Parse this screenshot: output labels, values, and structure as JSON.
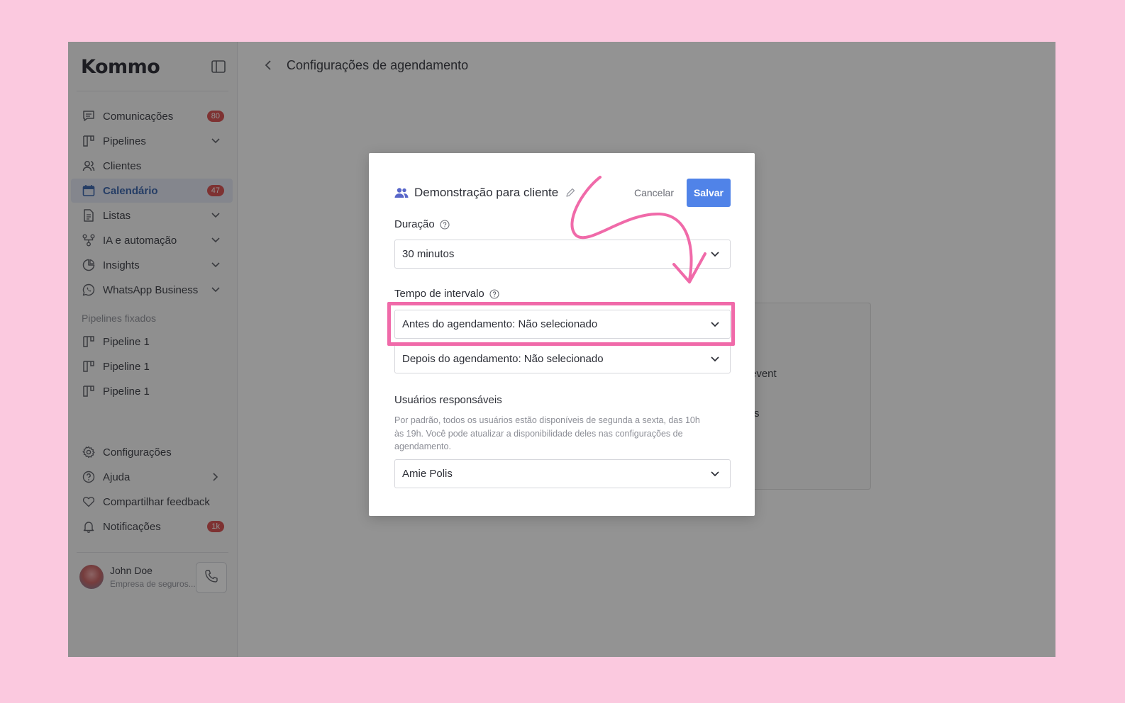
{
  "sidebar": {
    "logo": "Kommo",
    "nav_items": [
      {
        "label": "Comunicações",
        "badge": "80",
        "icon": "chat-icon"
      },
      {
        "label": "Pipelines",
        "icon": "pipeline-icon",
        "expandable": true
      },
      {
        "label": "Clientes",
        "icon": "users-icon"
      },
      {
        "label": "Calendário",
        "badge": "47",
        "icon": "calendar-icon",
        "active": true
      },
      {
        "label": "Listas",
        "icon": "document-icon",
        "expandable": true
      },
      {
        "label": "IA e automação",
        "icon": "automation-icon",
        "expandable": true
      },
      {
        "label": "Insights",
        "icon": "pie-chart-icon",
        "expandable": true
      },
      {
        "label": "WhatsApp Business",
        "icon": "whatsapp-icon",
        "expandable": true
      }
    ],
    "pinned_label": "Pipelines fixados",
    "pinned_items": [
      {
        "label": "Pipeline 1"
      },
      {
        "label": "Pipeline 1"
      },
      {
        "label": "Pipeline 1"
      }
    ],
    "bottom_items": [
      {
        "label": "Configurações",
        "icon": "gear-icon"
      },
      {
        "label": "Ajuda",
        "icon": "help-icon"
      },
      {
        "label": "Compartilhar feedback",
        "icon": "heart-icon"
      },
      {
        "label": "Notificações",
        "icon": "bell-icon",
        "badge": "1k"
      }
    ],
    "user": {
      "name": "John Doe",
      "company": "Empresa de seguros..."
    }
  },
  "header": {
    "title": "Configurações de agendamento"
  },
  "background_card": {
    "text1": "event",
    "text2": "rs"
  },
  "modal": {
    "title": "Demonstração para cliente",
    "cancel_label": "Cancelar",
    "save_label": "Salvar",
    "duration_label": "Duração",
    "duration_value": "30 minutos",
    "interval_label": "Tempo de intervalo",
    "before_value": "Antes do agendamento: Não selecionado",
    "after_value": "Depois do agendamento: Não selecionado",
    "users_label": "Usuários responsáveis",
    "users_help": "Por padrão, todos os usuários estão disponíveis de segunda a sexta, das 10h às 19h. Você pode atualizar a disponibilidade deles nas configurações de agendamento.",
    "user_value": "Amie Polis"
  },
  "colors": {
    "accent": "#5083e8",
    "highlight": "#f06aa9",
    "badge": "#d64545",
    "background": "#fbc9df"
  }
}
